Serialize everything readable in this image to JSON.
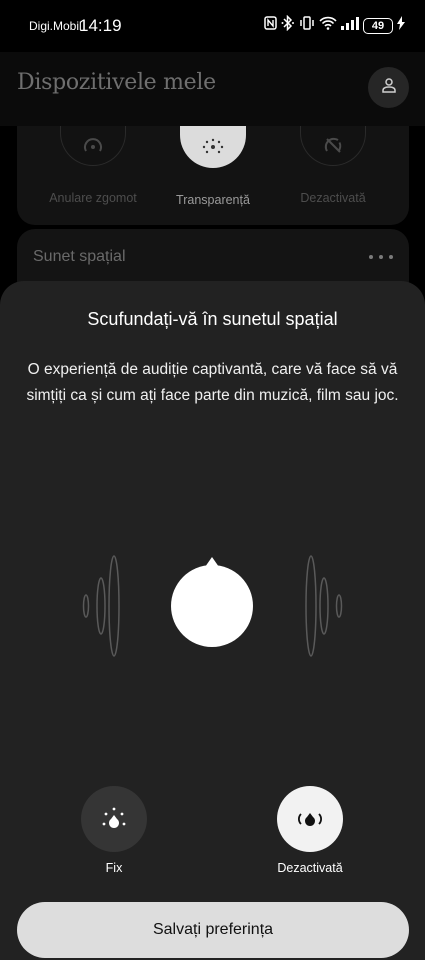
{
  "status_bar": {
    "carrier": "Digi.Mobil",
    "time": "14:19",
    "battery_level": "49",
    "icons": [
      "nfc-icon",
      "bluetooth-icon",
      "vibrate-icon",
      "wifi-icon",
      "signal-icon",
      "charging-icon"
    ]
  },
  "header": {
    "title": "Dispozitivele mele",
    "account_icon": "person-icon"
  },
  "noise_control": {
    "options": [
      {
        "label": "Anulare zgomot",
        "icon": "noise-cancel-icon",
        "active": false
      },
      {
        "label": "Transparență",
        "icon": "transparency-icon",
        "active": true
      },
      {
        "label": "Dezactivată",
        "icon": "off-icon",
        "active": false
      }
    ]
  },
  "spatial_card": {
    "title": "Sunet spațial",
    "more_icon": "more-icon"
  },
  "sheet": {
    "title": "Scufundați-vă în sunetul spațial",
    "description": "O experiență de audiție captivantă, care vă face să vă simțiți ca și cum ați face parte din muzică, film sau joc.",
    "modes": [
      {
        "label": "Fix",
        "icon": "fixed-sound-icon",
        "selected": false
      },
      {
        "label": "Dezactivată",
        "icon": "spatial-off-icon",
        "selected": true
      }
    ],
    "save_label": "Salvați preferința"
  },
  "colors": {
    "background": "#000000",
    "sheet": "#222222",
    "button": "#dddddd"
  }
}
